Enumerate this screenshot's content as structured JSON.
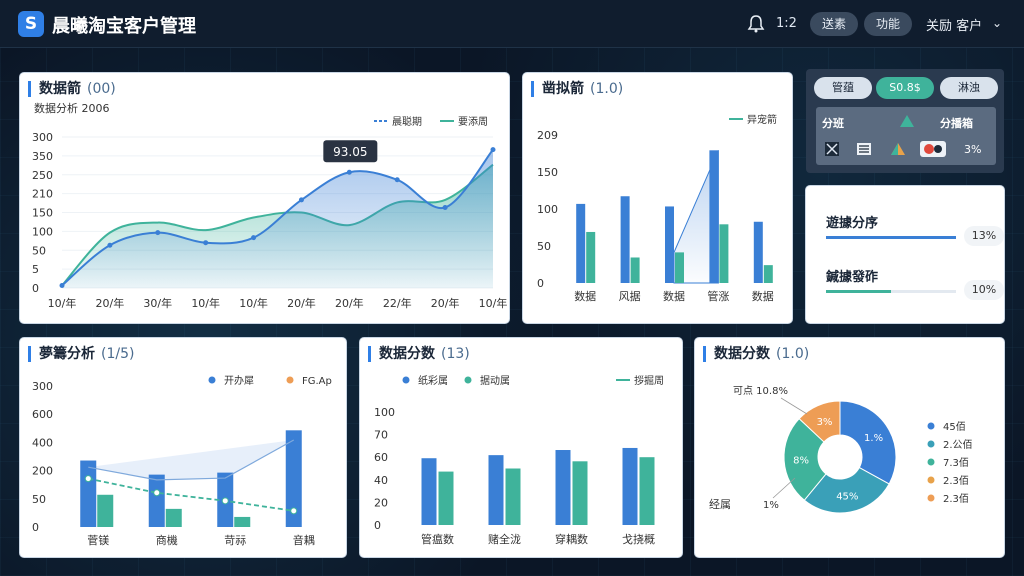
{
  "app": {
    "title": "晨曦淘宝客户管理",
    "logo_letter": "S"
  },
  "header": {
    "notification_count": "1:2",
    "btn_1": "送素",
    "btn_2": "功能",
    "user": "关励 客户"
  },
  "panel1": {
    "title": "数据箭",
    "title_suffix": "(00)",
    "subtitle": "数据分析 2006",
    "legend": [
      "晨聪期",
      "要添周"
    ],
    "tooltip": "93.05",
    "y_ticks": [
      "300",
      "350",
      "250",
      "210",
      "150",
      "100",
      "50",
      "5",
      "0"
    ],
    "x_ticks": [
      "10/年",
      "20/年",
      "30/年",
      "10/年",
      "10/年",
      "20/年",
      "20/年",
      "22/年",
      "20/年",
      "10/年"
    ]
  },
  "panel2": {
    "title": "凿拟箭",
    "title_suffix": "(1.0)",
    "legend": [
      "异宠箭"
    ],
    "y_ticks": [
      "209",
      "150",
      "100",
      "50",
      "0"
    ],
    "x_ticks": [
      "数据",
      "风据",
      "数据",
      "管涨",
      "数据"
    ]
  },
  "control": {
    "seg_1": "管蕴",
    "seg_2": "S0.8$",
    "seg_3": "淋浊",
    "label_left": "分班",
    "label_right": "分播箱",
    "pct": "3%"
  },
  "progress": [
    {
      "label": "遊據分序",
      "pct": "13%",
      "fill": 1.0,
      "color": "#3a7fd5"
    },
    {
      "label": "鍼據發砟",
      "pct": "10%",
      "fill": 0.5,
      "color": "#3fb39b"
    }
  ],
  "panel4": {
    "title": "夢籌分析",
    "title_suffix": "(1/5)",
    "legend": [
      "开办犀",
      "FG.Ap"
    ],
    "y_ticks": [
      "300",
      "600",
      "400",
      "200",
      "50",
      "0"
    ],
    "x_ticks": [
      "菅镁",
      "商機",
      "苛祘",
      "音耦"
    ]
  },
  "panel5": {
    "title": "数据分数",
    "title_suffix": "(13)",
    "legend": [
      "纸彩属",
      "据动属",
      "拶掘周"
    ],
    "y_ticks": [
      "100",
      "70",
      "60",
      "40",
      "20",
      "0"
    ],
    "x_ticks": [
      "管瘟数",
      "赌全泷",
      "穿耦数",
      "戈挠概"
    ]
  },
  "panel6": {
    "title": "数据分数",
    "title_suffix": "(1.0)",
    "callout_top": "可点 10.8%",
    "callout_bottom": "经属",
    "callout_bottom_pct": "1%",
    "slice_labels": [
      "1.%",
      "45%",
      "8%",
      "3%"
    ],
    "legend": [
      "45佰",
      "2.公佰",
      "7.3佰",
      "2.3佰",
      "2.3佰"
    ]
  },
  "chart_data": [
    {
      "type": "area",
      "title": "数据箭 (00)",
      "categories": [
        "10/年",
        "20/年",
        "30/年",
        "10/年",
        "10/年",
        "20/年",
        "20/年",
        "22/年",
        "20/年",
        "10/年"
      ],
      "series": [
        {
          "name": "晨聪期",
          "values": [
            5,
            85,
            110,
            90,
            100,
            175,
            230,
            215,
            160,
            275
          ]
        },
        {
          "name": "要添周",
          "values": [
            5,
            110,
            130,
            115,
            140,
            150,
            125,
            170,
            175,
            245
          ]
        }
      ],
      "annotation": "93.05"
    },
    {
      "type": "bar",
      "title": "凿拟箭 (1.0)",
      "categories": [
        "数据",
        "风据",
        "数据",
        "管涨",
        "数据"
      ],
      "series": [
        {
          "name": "bar-blue",
          "values": [
            155,
            170,
            150,
            260,
            120
          ]
        },
        {
          "name": "bar-green",
          "values": [
            100,
            50,
            60,
            115,
            35
          ]
        },
        {
          "name": "异宠箭",
          "values": [
            null,
            null,
            60,
            260,
            null
          ]
        }
      ],
      "ylim": [
        0,
        290
      ]
    },
    {
      "type": "bar",
      "title": "夢籌分析 (1/5)",
      "categories": [
        "菅镁",
        "商機",
        "苛祘",
        "音耦"
      ],
      "series": [
        {
          "name": "开办犀",
          "values": [
            330,
            260,
            270,
            480
          ]
        },
        {
          "name": "FG.Ap",
          "values": [
            160,
            90,
            50,
            0
          ]
        }
      ],
      "ylim": [
        0,
        700
      ]
    },
    {
      "type": "bar",
      "title": "数据分数 (13)",
      "categories": [
        "管瘟数",
        "赌全泷",
        "穿耦数",
        "戈挠概"
      ],
      "series": [
        {
          "name": "纸彩属",
          "values": [
            65,
            68,
            73,
            75
          ]
        },
        {
          "name": "据动属",
          "values": [
            52,
            55,
            62,
            66
          ]
        }
      ],
      "ylim": [
        0,
        110
      ]
    },
    {
      "type": "pie",
      "title": "数据分数 (1.0)",
      "labels": [
        "1.%",
        "45%",
        "8%",
        "3%"
      ],
      "values": [
        33,
        28,
        26,
        13
      ],
      "colors": [
        "#3a7fd5",
        "#3aa0b8",
        "#3fb39b",
        "#ee9d55"
      ]
    }
  ]
}
